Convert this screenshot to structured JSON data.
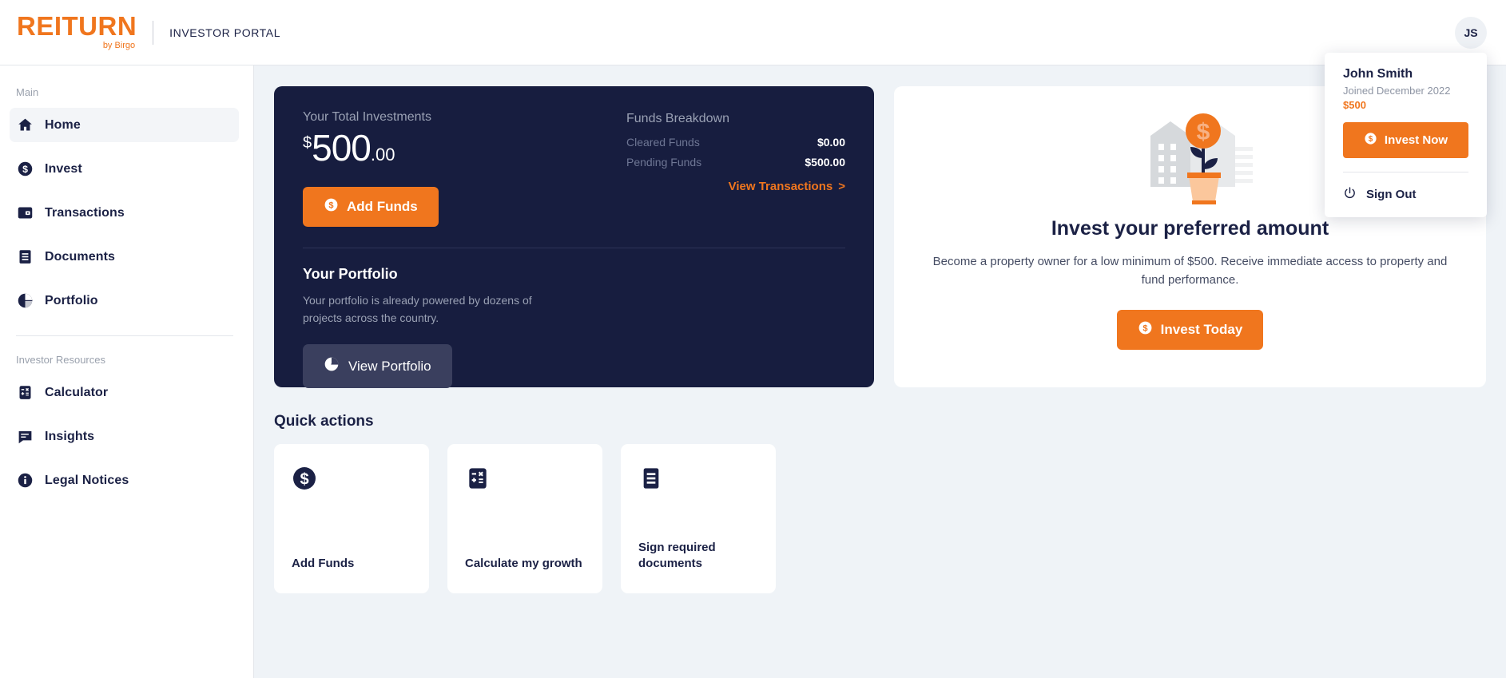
{
  "header": {
    "logo_text": "REITURN",
    "logo_sub": "by Birgo",
    "portal_title": "INVESTOR PORTAL",
    "avatar_initials": "JS"
  },
  "sidebar": {
    "main_label": "Main",
    "resources_label": "Investor Resources",
    "main_items": [
      {
        "label": "Home",
        "icon": "home-icon",
        "active": true
      },
      {
        "label": "Invest",
        "icon": "dollar-circle-icon",
        "active": false
      },
      {
        "label": "Transactions",
        "icon": "wallet-icon",
        "active": false
      },
      {
        "label": "Documents",
        "icon": "document-icon",
        "active": false
      },
      {
        "label": "Portfolio",
        "icon": "pie-chart-icon",
        "active": false
      }
    ],
    "resource_items": [
      {
        "label": "Calculator",
        "icon": "calculator-icon"
      },
      {
        "label": "Insights",
        "icon": "chat-icon"
      },
      {
        "label": "Legal Notices",
        "icon": "info-circle-icon"
      }
    ]
  },
  "summary_card": {
    "total_label": "Your Total Investments",
    "currency_symbol": "$",
    "amount_whole": "500",
    "amount_cents": ".00",
    "add_funds_label": "Add Funds",
    "funds_breakdown_title": "Funds Breakdown",
    "funds_rows": [
      {
        "key": "Cleared Funds",
        "value": "$0.00"
      },
      {
        "key": "Pending Funds",
        "value": "$500.00"
      }
    ],
    "view_transactions_label": "View Transactions",
    "view_transactions_chevron": ">",
    "portfolio_title": "Your Portfolio",
    "portfolio_text": "Your portfolio is already powered by dozens of projects across the country.",
    "view_portfolio_label": "View Portfolio"
  },
  "invest_card": {
    "title": "Invest your preferred amount",
    "text": "Become a property owner for a low minimum of $500. Receive immediate access to property and fund performance.",
    "button_label": "Invest Today"
  },
  "quick_actions": {
    "title": "Quick actions",
    "cards": [
      {
        "label": "Add Funds",
        "icon": "dollar-circle-icon"
      },
      {
        "label": "Calculate my growth",
        "icon": "calculator-icon"
      },
      {
        "label": "Sign required documents",
        "icon": "document-icon"
      }
    ]
  },
  "user_menu": {
    "name": "John Smith",
    "joined": "Joined December 2022",
    "amount": "$500",
    "invest_label": "Invest Now",
    "sign_out_label": "Sign Out"
  },
  "colors": {
    "accent_orange": "#f0761e",
    "navy": "#171d3f",
    "page_bg": "#eff3f7",
    "slate_button": "#3a3f5e"
  }
}
